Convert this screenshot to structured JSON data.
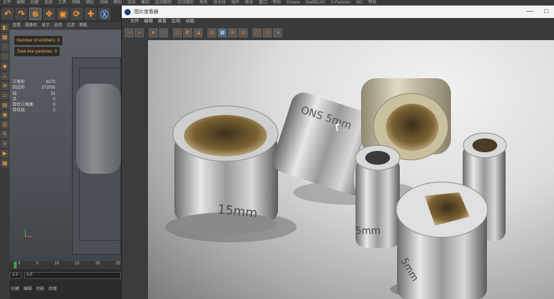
{
  "app": {
    "menubar_items": [
      "文件",
      "编辑",
      "创建",
      "选择",
      "工具",
      "网格",
      "捕捉",
      "动画",
      "模拟",
      "渲染",
      "雕刻",
      "运动跟踪",
      "运动图形",
      "角色",
      "流水线",
      "插件",
      "脚本",
      "窗口",
      "帮助",
      "Octane",
      "WaitBCAD",
      "X-Particles",
      "MC",
      "帮助"
    ]
  },
  "viewport": {
    "menu": [
      "查看",
      "摄像机",
      "显示",
      "选项",
      "过滤",
      "面板"
    ],
    "hud_emitters": "Number of emitters: 0",
    "hud_particles": "Total live particles: 0",
    "stats": [
      {
        "label": "三角形",
        "value": "6270"
      },
      {
        "label": "四边形",
        "value": "272050"
      },
      {
        "label": "线",
        "value": "31"
      },
      {
        "label": "点",
        "value": "0"
      },
      {
        "label": "带状三角面",
        "value": "0"
      },
      {
        "label": "带状线",
        "value": "0"
      }
    ]
  },
  "timeline": {
    "ticks": [
      "0",
      "5",
      "10",
      "15",
      "20",
      "25"
    ],
    "current_frame": "0 F",
    "min_frame": "0 F"
  },
  "attributes": {
    "tabs": [
      "创建",
      "编辑",
      "功能",
      "纹理"
    ]
  },
  "picture_viewer": {
    "title": "图片查看器",
    "menu": [
      "文件",
      "编辑",
      "查看",
      "比较",
      "动画"
    ],
    "window_controls": [
      "—",
      "□"
    ]
  },
  "colors": {
    "accent_orange": "#ff9a2e",
    "hud_text": "#ffa640",
    "viewport_bg": "#4b5156",
    "titlebar": "#f3f3f3"
  }
}
